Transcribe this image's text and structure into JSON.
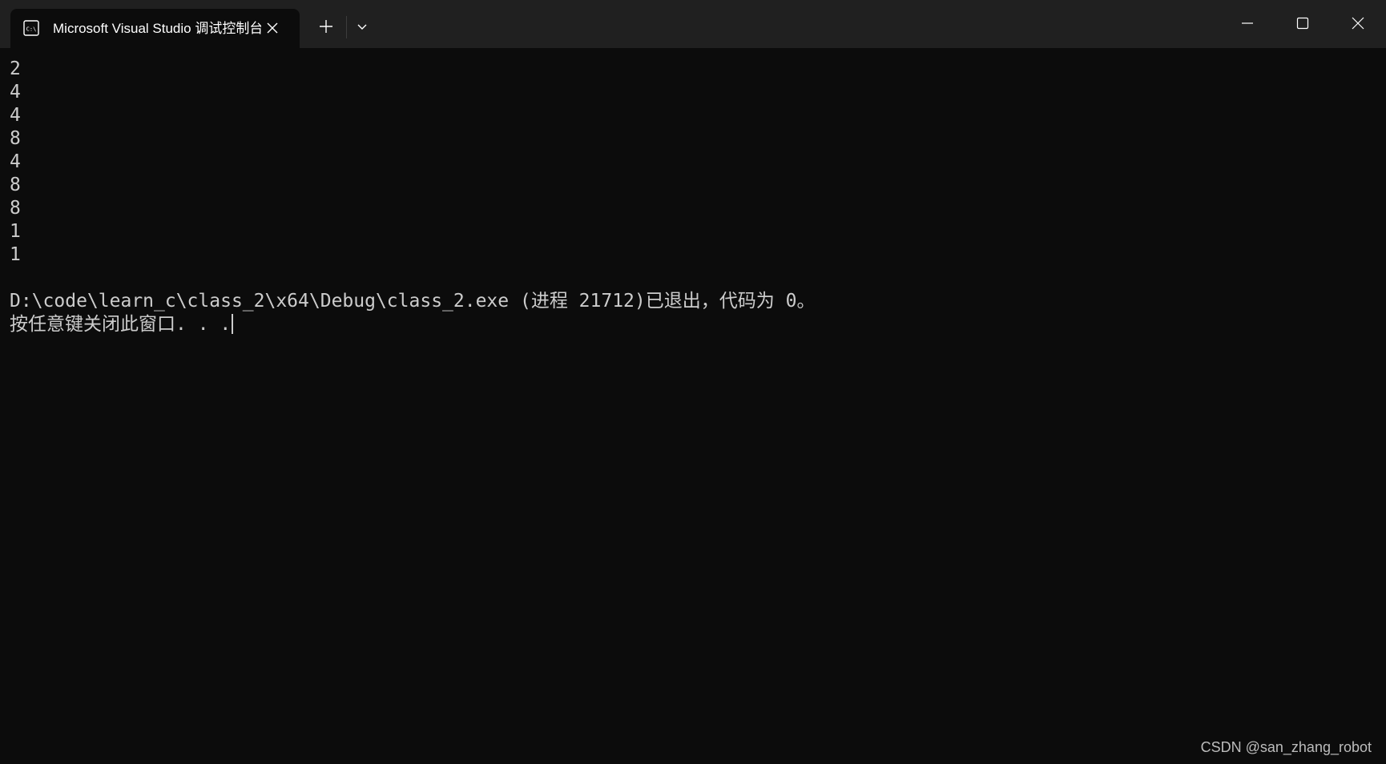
{
  "window": {
    "tab_title": "Microsoft Visual Studio 调试控制台",
    "icons": {
      "tab": "console-icon",
      "tab_close": "close-icon",
      "new_tab": "plus-icon",
      "dropdown": "chevron-down-icon",
      "minimize": "minimize-icon",
      "maximize": "maximize-icon",
      "close": "close-icon"
    },
    "colors": {
      "titlebar": "#202020",
      "background": "#0c0c0c",
      "text": "#cccccc"
    }
  },
  "console": {
    "lines": [
      "2",
      "4",
      "4",
      "8",
      "4",
      "8",
      "8",
      "1",
      "1",
      "",
      "D:\\code\\learn_c\\class_2\\x64\\Debug\\class_2.exe (进程 21712)已退出，代码为 0。",
      "按任意键关闭此窗口. . ."
    ]
  },
  "watermark": "CSDN @san_zhang_robot"
}
